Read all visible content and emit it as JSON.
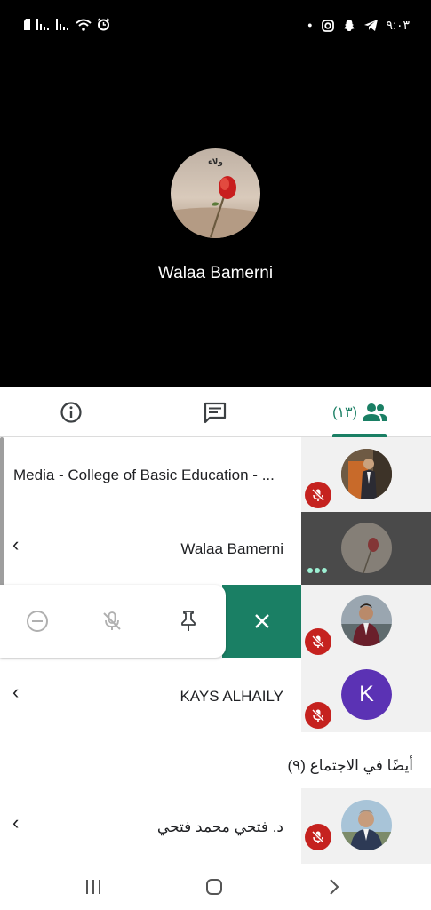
{
  "status_bar": {
    "time": "٩:٠٣",
    "left_icons": [
      "sim-icon",
      "signal-icon",
      "signal-icon",
      "wifi-icon",
      "alarm-icon"
    ],
    "right_icons": [
      "dot-icon",
      "instagram-icon",
      "snapchat-icon",
      "telegram-icon"
    ]
  },
  "video": {
    "speaker_name": "Walaa Bamerni",
    "avatar_caption": "ولاء"
  },
  "tabs": {
    "people_count": "(١٣)"
  },
  "participants": [
    {
      "name": "Media - College of Basic Education - ...",
      "muted": true
    },
    {
      "name": "Walaa Bamerni",
      "muted": false,
      "speaking": true
    },
    {
      "name": "",
      "muted": true
    },
    {
      "name": "KAYS ALHAILY",
      "avatar_letter": "K",
      "avatar_color": "#5b32b4",
      "muted": true
    }
  ],
  "section": {
    "title": "أيضًا في الاجتماع (٩)"
  },
  "others": [
    {
      "name": "د. فتحي محمد فتحي",
      "muted": true
    }
  ],
  "colors": {
    "accent": "#1a7f64",
    "mute": "#c5221f"
  }
}
